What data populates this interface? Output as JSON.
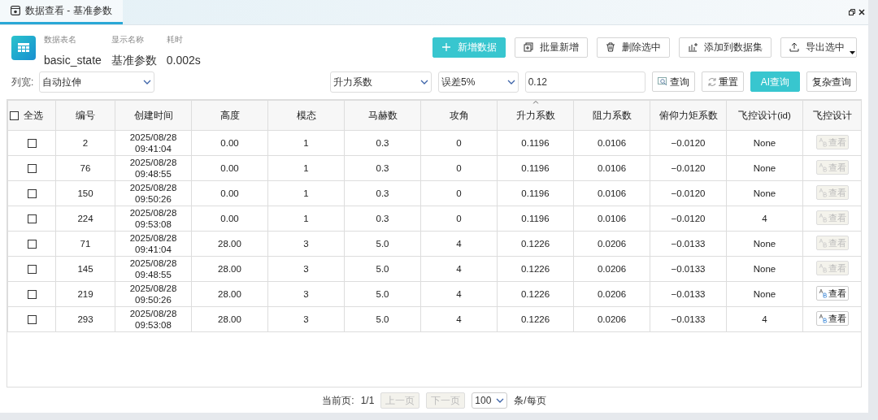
{
  "tab": {
    "title": "数据查看 - 基准参数",
    "selected": true
  },
  "info": [
    {
      "label": "数据表名",
      "value": "basic_state"
    },
    {
      "label": "显示名称",
      "value": "基准参数"
    },
    {
      "label": "耗时",
      "value": "0.002s"
    }
  ],
  "actions": [
    {
      "kind": "primary",
      "label": "新增数据"
    },
    {
      "kind": "normal",
      "label": "批量新增"
    },
    {
      "kind": "normal",
      "label": "删除选中"
    },
    {
      "kind": "normal",
      "label": "添加到数据集"
    },
    {
      "kind": "menu",
      "label": "导出选中"
    }
  ],
  "filters": {
    "width_label": "列宽:",
    "width_value": "自动拉伸",
    "field_value": "升力系数",
    "tolerance_value": "误差5%",
    "query_value": "0.12"
  },
  "query_buttons": [
    {
      "kind": "search",
      "label": "查询"
    },
    {
      "kind": "reset",
      "label": "重置"
    },
    {
      "kind": "primary",
      "label": "AI查询"
    },
    {
      "kind": "plain",
      "label": "复杂查询"
    }
  ],
  "table": {
    "select_all": {
      "label": "全选",
      "checked": false
    },
    "columns": [
      {
        "label": "编号",
        "sorted": false
      },
      {
        "label": "创建时间",
        "sorted": false
      },
      {
        "label": "高度",
        "sorted": false
      },
      {
        "label": "模态",
        "sorted": false
      },
      {
        "label": "马赫数",
        "sorted": false
      },
      {
        "label": "攻角",
        "sorted": false
      },
      {
        "label": "升力系数",
        "sorted": true
      },
      {
        "label": "阻力系数",
        "sorted": false
      },
      {
        "label": "俯仰力矩系数",
        "sorted": false
      },
      {
        "label": "飞控设计(id)",
        "sorted": false
      },
      {
        "label": "飞控设计",
        "sorted": false
      }
    ],
    "rows": [
      {
        "checked": false,
        "cells": [
          "2",
          "2025/08/28 09:41:04",
          "0.00",
          "1",
          "0.3",
          "0",
          "0.1196",
          "0.0106",
          "−0.0120",
          "None"
        ],
        "view": {
          "label": "查看",
          "disabled": true
        }
      },
      {
        "checked": false,
        "cells": [
          "76",
          "2025/08/28 09:48:55",
          "0.00",
          "1",
          "0.3",
          "0",
          "0.1196",
          "0.0106",
          "−0.0120",
          "None"
        ],
        "view": {
          "label": "查看",
          "disabled": true
        }
      },
      {
        "checked": false,
        "cells": [
          "150",
          "2025/08/28 09:50:26",
          "0.00",
          "1",
          "0.3",
          "0",
          "0.1196",
          "0.0106",
          "−0.0120",
          "None"
        ],
        "view": {
          "label": "查看",
          "disabled": true
        }
      },
      {
        "checked": false,
        "cells": [
          "224",
          "2025/08/28 09:53:08",
          "0.00",
          "1",
          "0.3",
          "0",
          "0.1196",
          "0.0106",
          "−0.0120",
          "4"
        ],
        "view": {
          "label": "查看",
          "disabled": true
        }
      },
      {
        "checked": false,
        "cells": [
          "71",
          "2025/08/28 09:41:04",
          "28.00",
          "3",
          "5.0",
          "4",
          "0.1226",
          "0.0206",
          "−0.0133",
          "None"
        ],
        "view": {
          "label": "查看",
          "disabled": true
        }
      },
      {
        "checked": false,
        "cells": [
          "145",
          "2025/08/28 09:48:55",
          "28.00",
          "3",
          "5.0",
          "4",
          "0.1226",
          "0.0206",
          "−0.0133",
          "None"
        ],
        "view": {
          "label": "查看",
          "disabled": true
        }
      },
      {
        "checked": false,
        "cells": [
          "219",
          "2025/08/28 09:50:26",
          "28.00",
          "3",
          "5.0",
          "4",
          "0.1226",
          "0.0206",
          "−0.0133",
          "None"
        ],
        "view": {
          "label": "查看",
          "disabled": false
        }
      },
      {
        "checked": false,
        "cells": [
          "293",
          "2025/08/28 09:53:08",
          "28.00",
          "3",
          "5.0",
          "4",
          "0.1226",
          "0.0206",
          "−0.0133",
          "4"
        ],
        "view": {
          "label": "查看",
          "disabled": false
        }
      }
    ]
  },
  "pagination": {
    "label": "当前页:",
    "page": "1/1",
    "prev": {
      "label": "上一页",
      "disabled": true
    },
    "next": {
      "label": "下一页",
      "disabled": true
    },
    "page_size": "100",
    "unit": "条/每页"
  }
}
